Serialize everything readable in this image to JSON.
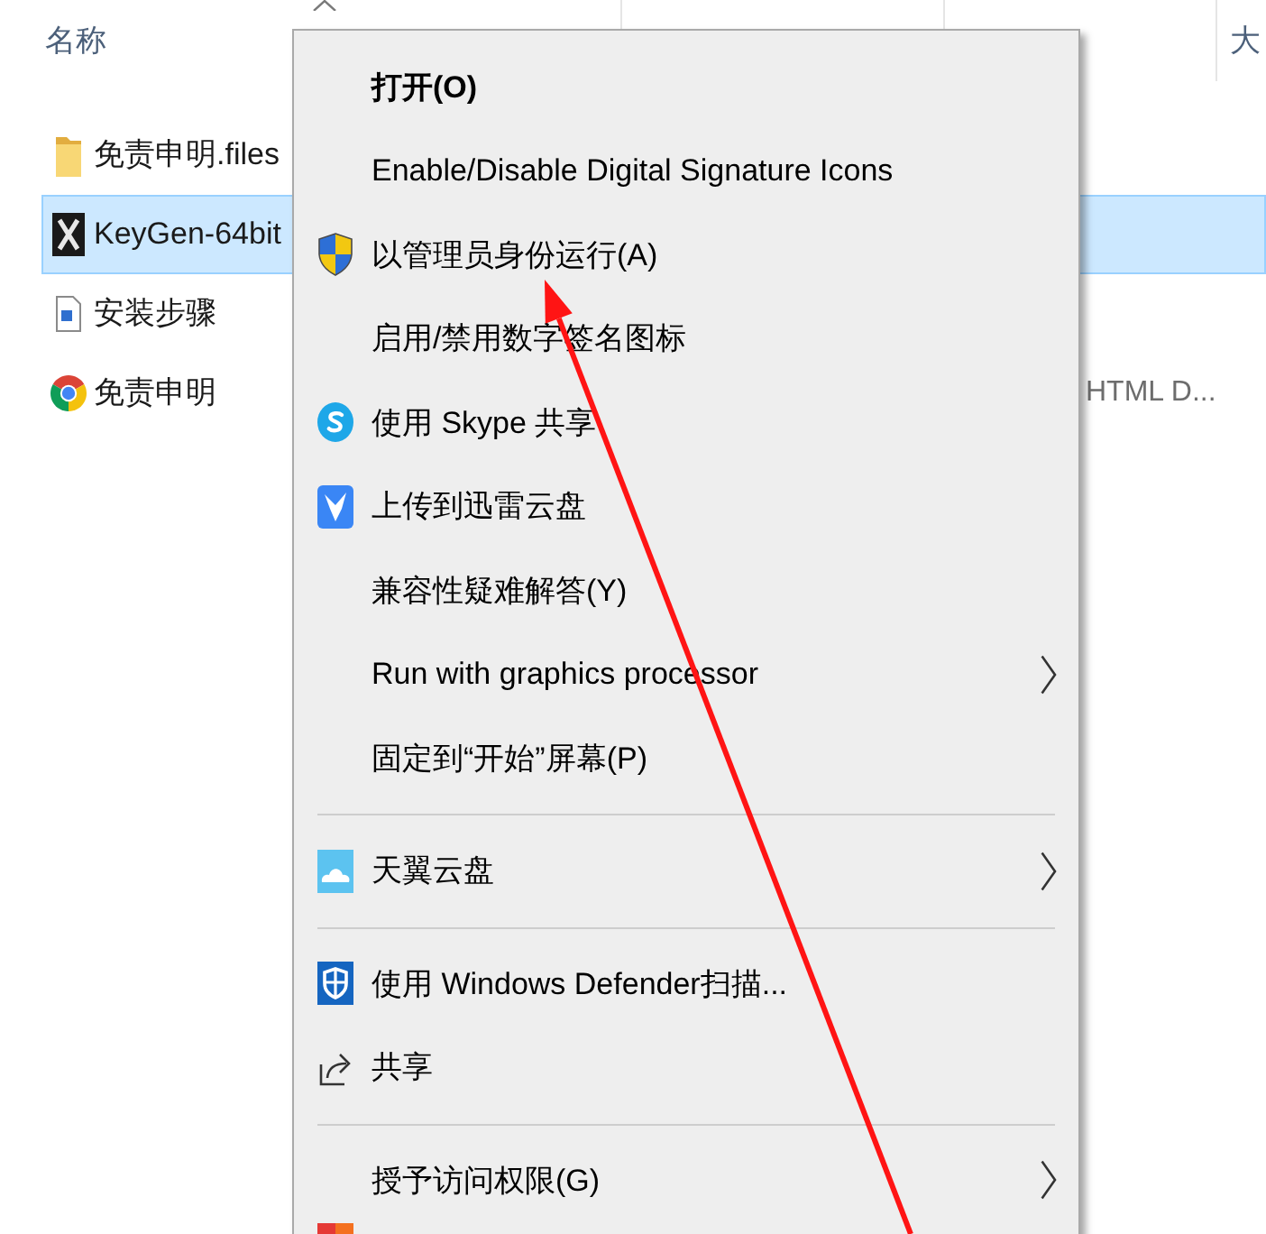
{
  "file_list": {
    "columns": [
      {
        "label": "名称",
        "sorted": true
      },
      {
        "sorted": false
      },
      {
        "sorted": false
      },
      {
        "label": "大",
        "sorted": false
      }
    ],
    "rows": [
      {
        "kind": "folder",
        "name": "免责申明.files",
        "selected": false
      },
      {
        "kind": "app",
        "name": "KeyGen-64bit",
        "selected": true
      },
      {
        "kind": "document",
        "name": "安装步骤",
        "selected": false
      },
      {
        "kind": "browser",
        "name": "免责申明",
        "type": "HTML D...",
        "selected": false
      }
    ]
  },
  "context_menu": {
    "items": [
      {
        "kind": "plain",
        "label": "打开(O)",
        "default": true,
        "submenu": false
      },
      {
        "kind": "plain",
        "label": "Enable/Disable Digital Signature Icons",
        "default": false,
        "submenu": false
      },
      {
        "kind": "shield",
        "label": "以管理员身份运行(A)",
        "default": false,
        "submenu": false
      },
      {
        "kind": "plain",
        "label": "启用/禁用数字签名图标",
        "default": false,
        "submenu": false
      },
      {
        "kind": "skype",
        "label": "使用 Skype 共享",
        "default": false,
        "submenu": false
      },
      {
        "kind": "thunder",
        "label": "上传到迅雷云盘",
        "default": false,
        "submenu": false
      },
      {
        "kind": "plain",
        "label": "兼容性疑难解答(Y)",
        "default": false,
        "submenu": false
      },
      {
        "kind": "plain",
        "label": "Run with graphics processor",
        "default": false,
        "submenu": true
      },
      {
        "kind": "plain",
        "label": "固定到“开始”屏幕(P)",
        "default": false,
        "submenu": false
      },
      {
        "kind": "separator"
      },
      {
        "kind": "cloud",
        "label": "天翼云盘",
        "default": false,
        "submenu": true
      },
      {
        "kind": "separator"
      },
      {
        "kind": "defender",
        "label": "使用 Windows Defender扫描...",
        "default": false,
        "submenu": false
      },
      {
        "kind": "share",
        "label": "共享",
        "default": false,
        "submenu": false
      },
      {
        "kind": "separator"
      },
      {
        "kind": "plain",
        "label": "授予访问权限(G)",
        "default": false,
        "submenu": true
      },
      {
        "kind": "tile"
      }
    ]
  },
  "annotations": [
    {
      "kind": "arrow"
    }
  ]
}
